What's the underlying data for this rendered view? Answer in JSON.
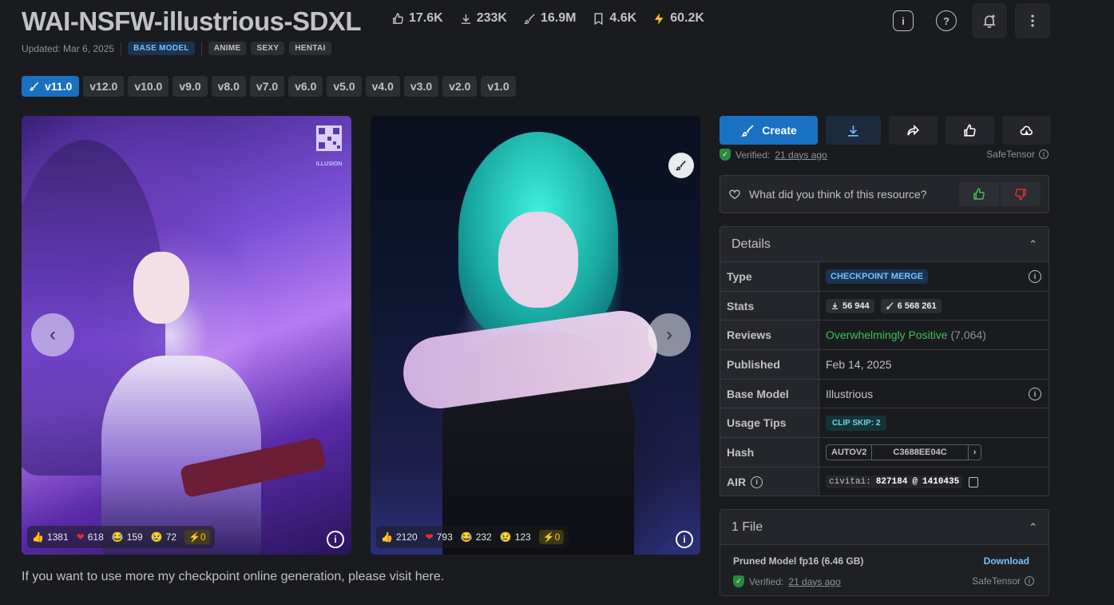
{
  "header": {
    "title": "WAI-NSFW-illustrious-SDXL",
    "stats": {
      "likes": "17.6K",
      "downloads": "233K",
      "generations": "16.9M",
      "bookmarks": "4.6K",
      "buzz": "60.2K"
    },
    "info_icon": "i",
    "help_icon": "?"
  },
  "meta": {
    "updated": "Updated: Mar 6, 2025",
    "tags": [
      "BASE MODEL",
      "ANIME",
      "SEXY",
      "HENTAI"
    ]
  },
  "versions": [
    "v11.0",
    "v12.0",
    "v10.0",
    "v9.0",
    "v8.0",
    "v7.0",
    "v6.0",
    "v5.0",
    "v4.0",
    "v3.0",
    "v2.0",
    "v1.0"
  ],
  "gallery": {
    "image1": {
      "reactions": {
        "like": "1381",
        "heart": "618",
        "laugh": "159",
        "cry": "72",
        "buzz": "0"
      },
      "watermark": "ILLUSION"
    },
    "image2": {
      "reactions": {
        "like": "2120",
        "heart": "793",
        "laugh": "232",
        "cry": "123",
        "buzz": "0"
      }
    }
  },
  "description": "If you want to use more my checkpoint online generation, please visit here.",
  "actions": {
    "create_label": "Create",
    "verified_prefix": "Verified:",
    "verified_when": "21 days ago",
    "format": "SafeTensor"
  },
  "feedback": {
    "question": "What did you think of this resource?"
  },
  "details": {
    "title": "Details",
    "rows": {
      "type_label": "Type",
      "type_value": "CHECKPOINT MERGE",
      "stats_label": "Stats",
      "stats_downloads": "56 944",
      "stats_generations": "6 568 261",
      "reviews_label": "Reviews",
      "reviews_value": "Overwhelmingly Positive",
      "reviews_count": "(7,064)",
      "published_label": "Published",
      "published_value": "Feb 14, 2025",
      "base_label": "Base Model",
      "base_value": "Illustrious",
      "tips_label": "Usage Tips",
      "tips_value": "CLIP SKIP: 2",
      "hash_label": "Hash",
      "hash_type": "AUTOV2",
      "hash_value": "C3688EE04C",
      "air_label": "AIR",
      "air_prefix": "civitai:",
      "air_model": "827184",
      "air_at": "@",
      "air_version": "1410435"
    }
  },
  "files": {
    "title": "1 File",
    "name": "Pruned Model fp16 (6.46 GB)",
    "download": "Download",
    "verified_prefix": "Verified:",
    "verified_when": "21 days ago",
    "format": "SafeTensor"
  },
  "colors": {
    "accent": "#1971c2",
    "background": "#1a1b1e",
    "panel": "#25262b",
    "positive": "#40c057"
  }
}
